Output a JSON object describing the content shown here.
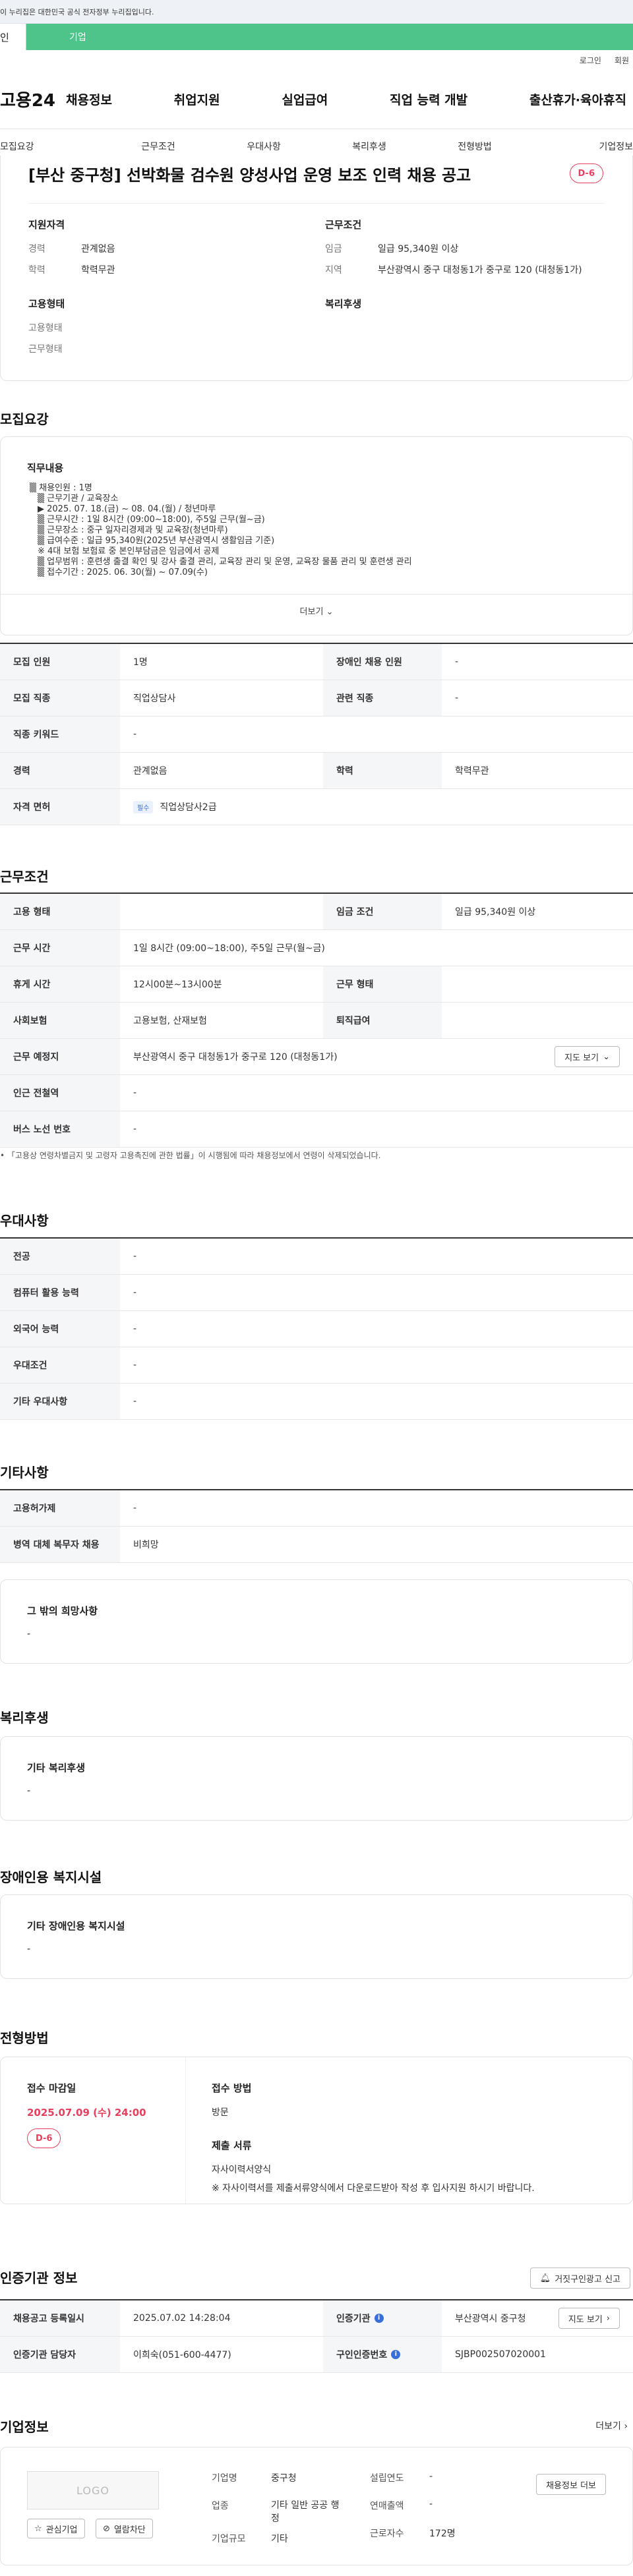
{
  "gov_banner": "이 누리집은 대한민국 공식 전자정부 누리집입니다.",
  "tabs": {
    "person": "인",
    "business": "기업"
  },
  "util": {
    "login": "로그인",
    "join": "회원"
  },
  "gnb": {
    "logo": "고용24",
    "menu": [
      "채용정보",
      "취업지원",
      "실업급여",
      "직업 능력 개발",
      "출산휴가·육아휴직"
    ]
  },
  "subtabs": [
    "모집요강",
    "근무조건",
    "우대사항",
    "복리후생",
    "전형방법",
    "기업정보"
  ],
  "hero": {
    "title": "[부산 중구청] 선박화물 검수원 양성사업 운영 보조 인력 채용 공고",
    "dday": "D-6",
    "qual_title": "지원자격",
    "qual": [
      {
        "k": "경력",
        "v": "관계없음"
      },
      {
        "k": "학력",
        "v": "학력무관"
      }
    ],
    "cond_title": "근무조건",
    "cond": [
      {
        "k": "임금",
        "v": "일급 95,340원 이상"
      },
      {
        "k": "지역",
        "v": "부산광역시 중구 대청동1가 중구로 120 (대청동1가)"
      }
    ],
    "emp_title": "고용형태",
    "emp": [
      "고용형태",
      "근무형태"
    ],
    "welfare_title": "복리후생"
  },
  "recruit": {
    "title": "모집요강",
    "duty_title": "직무내용",
    "duty_lines": [
      "▒ 채용인원 : 1명",
      "▒ 근무기관 / 교육장소",
      "▶ 2025. 07. 18.(금) ~ 08. 04.(월) / 청년마루",
      "▒ 근무시간 : 1일 8시간 (09:00~18:00), 주5일 근무(월~금)",
      "▒ 근무장소 : 중구 일자리경제과 및 교육장(청년마루)",
      "▒ 급여수준 : 일급 95,340원(2025년 부산광역시 생활임금 기준)",
      "※ 4대 보험 보험료 중 본인부담금은 임금에서 공제",
      "▒ 업무범위 : 훈련생 출결 확인 및 강사 출결 관리, 교육장 관리 및 운영, 교육장 물품 관리 및 훈련생 관리",
      "▒ 접수기간 : 2025. 06. 30(월) ~ 07.09(수)"
    ],
    "more": "더보기",
    "rows": [
      {
        "k1": "모집 인원",
        "v1": "1명",
        "k2": "장애인 채용 인원",
        "v2": "-"
      },
      {
        "k1": "모집 직종",
        "v1": "직업상담사",
        "k2": "관련 직종",
        "v2": "-"
      },
      {
        "k1": "직종 키워드",
        "v1": "-"
      },
      {
        "k1": "경력",
        "v1": "관계없음",
        "k2": "학력",
        "v2": "학력무관"
      },
      {
        "k1": "자격 면허",
        "tag": "필수",
        "v1": "직업상담사2급"
      }
    ]
  },
  "work": {
    "title": "근무조건",
    "rows": [
      {
        "k1": "고용 형태",
        "v1": "",
        "k2": "임금 조건",
        "v2": "일급 95,340원 이상"
      },
      {
        "k1": "근무 시간",
        "v1": "1일 8시간 (09:00~18:00), 주5일 근무(월~금)"
      },
      {
        "k1": "휴게 시간",
        "v1": "12시00분~13시00분",
        "k2": "근무 형태",
        "v2": ""
      },
      {
        "k1": "사회보험",
        "v1": "고용보험, 산재보험",
        "k2": "퇴직급여",
        "v2": ""
      },
      {
        "k1": "근무 예정지",
        "v1": "부산광역시 중구 대청동1가 중구로 120 (대청동1가)",
        "btn": "지도 보기"
      },
      {
        "k1": "인근 전철역",
        "v1": "-"
      },
      {
        "k1": "버스 노선 번호",
        "v1": "-"
      }
    ],
    "note": "「고용상 연령차별금지 및 고령자 고용촉진에 관한 법률」이 시행됨에 따라 채용정보에서 연령이 삭제되었습니다."
  },
  "pref": {
    "title": "우대사항",
    "rows": [
      {
        "k": "전공",
        "v": "-"
      },
      {
        "k": "컴퓨터 활용 능력",
        "v": "-"
      },
      {
        "k": "외국어 능력",
        "v": "-"
      },
      {
        "k": "우대조건",
        "v": "-"
      },
      {
        "k": "기타 우대사항",
        "v": "-"
      }
    ]
  },
  "etc": {
    "title": "기타사항",
    "rows": [
      {
        "k": "고용허가제",
        "v": "-"
      },
      {
        "k": "병역 대체 복무자 채용",
        "v": "비희망"
      }
    ],
    "box_title": "그 밖의 희망사항",
    "box_value": "-"
  },
  "welfare": {
    "title": "복리후생",
    "box_title": "기타 복리후생",
    "box_value": "-"
  },
  "disabled": {
    "title": "장애인용 복지시설",
    "box_title": "기타 장애인용 복지시설",
    "box_value": "-"
  },
  "screening": {
    "title": "전형방법",
    "deadline_title": "접수 마감일",
    "deadline": "2025.07.09 (수) 24:00",
    "dday": "D-6",
    "method_title": "접수 방법",
    "method": "방문",
    "docs_title": "제출 서류",
    "docs_1": "자사이력서양식",
    "docs_2": "※ 자사이력서를 제출서류양식에서 다운로드받아 작성 후 입사지원 하시기 바랍니다."
  },
  "cert": {
    "title": "인증기관 정보",
    "report_btn": "거짓구인광고 신고",
    "rows": [
      {
        "k1": "채용공고 등록일시",
        "v1": "2025.07.02 14:28:04",
        "k2": "인증기관",
        "v2": "부산광역시 중구청",
        "btn": "지도 보기"
      },
      {
        "k1": "인증기관 담당자",
        "v1": "이희숙(051-600-4477)",
        "k2": "구인인증번호",
        "v2": "SJBP002507020001"
      }
    ]
  },
  "company": {
    "title": "기업정보",
    "more": "더보기",
    "logo": "LOGO",
    "fav_btn": "관심기업",
    "block_btn": "열람차단",
    "info": [
      {
        "k": "기업명",
        "v": "중구청"
      },
      {
        "k": "업종",
        "v": "기타 일반 공공 행정"
      },
      {
        "k": "기업규모",
        "v": "기타"
      }
    ],
    "info2": [
      {
        "k": "설립연도",
        "v": "-"
      },
      {
        "k": "연매출액",
        "v": "-"
      },
      {
        "k": "근로자수",
        "v": "172명"
      }
    ],
    "hire_btn": "채용정보 더보"
  }
}
